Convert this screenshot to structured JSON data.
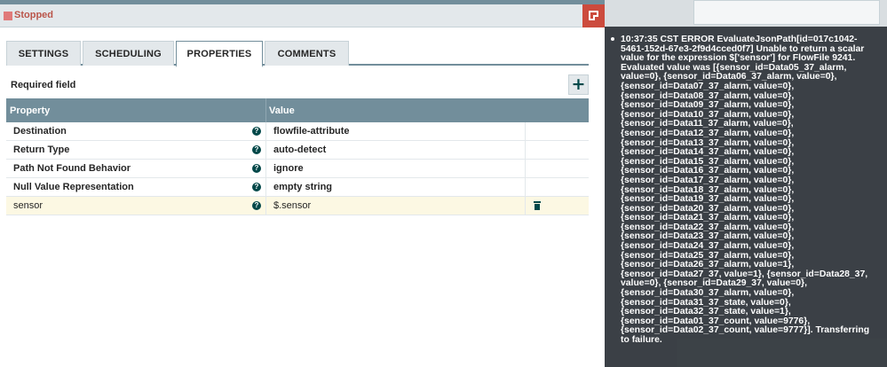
{
  "dialog": {
    "status_text": "Stopped",
    "tabs": [
      {
        "label": "SETTINGS"
      },
      {
        "label": "SCHEDULING"
      },
      {
        "label": "PROPERTIES"
      },
      {
        "label": "COMMENTS"
      }
    ],
    "active_tab": "PROPERTIES",
    "required_field_label": "Required field",
    "add_button_glyph": "+",
    "table": {
      "headers": {
        "property": "Property",
        "value": "Value"
      },
      "rows": [
        {
          "name": "Destination",
          "value": "flowfile-attribute",
          "required": true
        },
        {
          "name": "Return Type",
          "value": "auto-detect",
          "required": true
        },
        {
          "name": "Path Not Found Behavior",
          "value": "ignore",
          "required": true
        },
        {
          "name": "Null Value Representation",
          "value": "empty string",
          "required": true
        },
        {
          "name": "sensor",
          "value": "$.sensor",
          "required": false,
          "selected": true
        }
      ]
    }
  },
  "tooltip": {
    "message": "10:37:35 CST ERROR EvaluateJsonPath[id=017c1042-5461-152d-67e3-2f9d4cced0f7] Unable to return a scalar value for the expression $['sensor'] for FlowFile 9241. Evaluated value was [{sensor_id=Data05_37_alarm, value=0}, {sensor_id=Data06_37_alarm, value=0}, {sensor_id=Data07_37_alarm, value=0}, {sensor_id=Data08_37_alarm, value=0}, {sensor_id=Data09_37_alarm, value=0}, {sensor_id=Data10_37_alarm, value=0}, {sensor_id=Data11_37_alarm, value=0}, {sensor_id=Data12_37_alarm, value=0}, {sensor_id=Data13_37_alarm, value=0}, {sensor_id=Data14_37_alarm, value=0}, {sensor_id=Data15_37_alarm, value=0}, {sensor_id=Data16_37_alarm, value=0}, {sensor_id=Data17_37_alarm, value=0}, {sensor_id=Data18_37_alarm, value=0}, {sensor_id=Data19_37_alarm, value=0}, {sensor_id=Data20_37_alarm, value=0}, {sensor_id=Data21_37_alarm, value=0}, {sensor_id=Data22_37_alarm, value=0}, {sensor_id=Data23_37_alarm, value=0}, {sensor_id=Data24_37_alarm, value=0}, {sensor_id=Data25_37_alarm, value=0}, {sensor_id=Data26_37_alarm, value=1}, {sensor_id=Data27_37, value=1}, {sensor_id=Data28_37, value=0}, {sensor_id=Data29_37, value=0}, {sensor_id=Data30_37_alarm, value=0}, {sensor_id=Data31_37_state, value=0}, {sensor_id=Data32_37_state, value=1}, {sensor_id=Data01_37_count, value=9776}, {sensor_id=Data02_37_count, value=9777}]. Transferring to failure."
  },
  "colors": {
    "header_bar": "#728e9b",
    "status_stopped": "#ba554a",
    "close_button": "#cc4b3d",
    "accent": "#004849",
    "selected_row": "#fcf8e3",
    "tooltip_bg": "#343a40"
  },
  "icons": {
    "status": "stopped-square-icon",
    "header_button": "popout-icon",
    "info": "question-circle-icon",
    "delete": "trash-icon",
    "add": "plus-icon"
  }
}
